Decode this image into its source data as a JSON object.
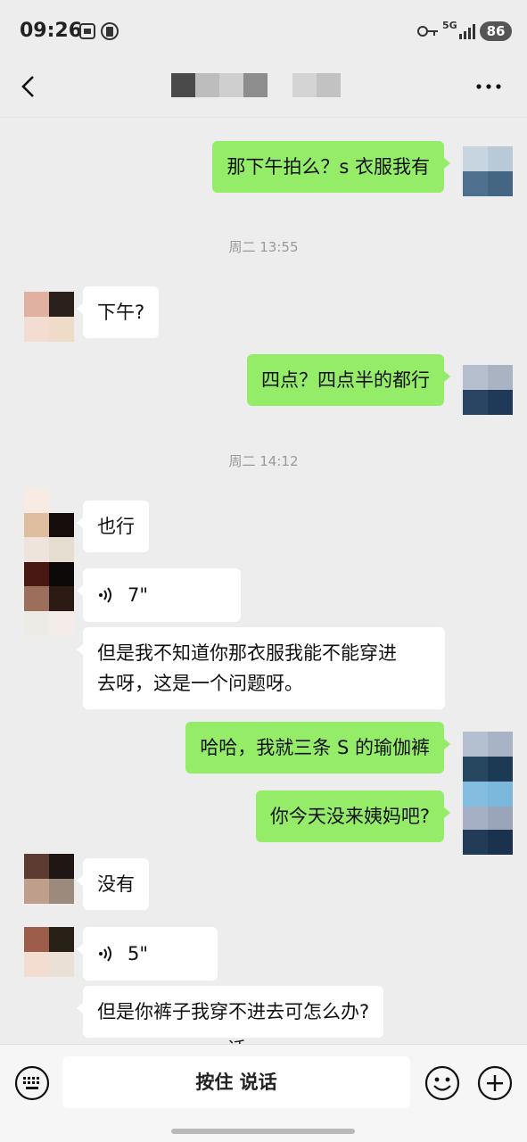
{
  "status": {
    "time": "09:26",
    "network": "5G",
    "battery": "86"
  },
  "header": {
    "title": "",
    "more": "···"
  },
  "messages": {
    "m1": "那下午拍么？s 衣服我有",
    "t1": "周二 13:55",
    "m2": "下午?",
    "m3": "四点？四点半的都行",
    "t2": "周二 14:12",
    "m4": "也行",
    "m5": "7\"",
    "m6a": "但是我不知道你那衣服我能不能穿进",
    "m6b": "去呀，这是一个问题呀。",
    "m7": "哈哈，我就三条 S 的瑜伽裤",
    "m8": "你今天没来姨妈吧?",
    "m9": "没有",
    "m10": "5\"",
    "m11": "但是你裤子我穿不进去可怎么办?"
  },
  "input": {
    "overlay_char": "话",
    "hold_to_talk": "按住 说话"
  },
  "icons": {
    "back": "back-arrow-icon",
    "more": "more-dots-icon",
    "voice": "voice-wave-icon",
    "keyboard": "keyboard-icon",
    "emoji": "emoji-icon",
    "plus": "plus-icon"
  },
  "colors": {
    "out_bubble": "#95ec69",
    "in_bubble": "#ffffff",
    "background": "#ededed"
  }
}
